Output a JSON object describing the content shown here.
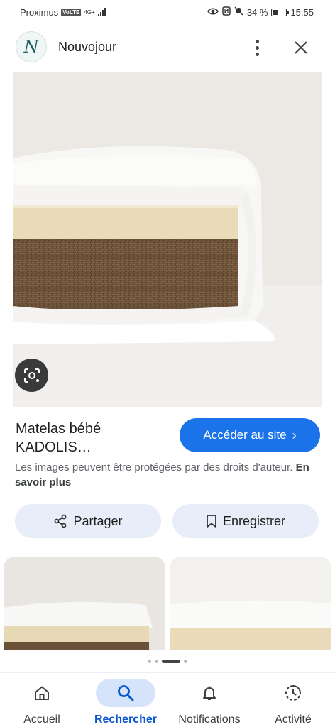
{
  "status_bar": {
    "carrier": "Proximus",
    "volte_badge": "VoLTE",
    "network": "4G+",
    "battery": "34 %",
    "battery_level": 0.34,
    "time": "15:55"
  },
  "header": {
    "logo_letter": "N",
    "site_name": "Nouvojour",
    "more_icon": "more-vertical-icon",
    "close_icon": "close-icon"
  },
  "image_result": {
    "lens_icon": "lens-search-icon",
    "title": "Matelas bébé KADOLIS…",
    "visit_label": "Accéder au site",
    "visit_chevron": "›",
    "copyright_text": "Les images peuvent être protégées par des droits d'auteur.",
    "learn_more": "En savoir plus"
  },
  "actions": {
    "share_label": "Partager",
    "save_label": "Enregistrer"
  },
  "carousel": {
    "page_count": 4,
    "active_index": 2
  },
  "bottom_nav": [
    {
      "label": "Accueil",
      "icon": "home-icon"
    },
    {
      "label": "Rechercher",
      "icon": "search-icon"
    },
    {
      "label": "Notifications",
      "icon": "bell-icon"
    },
    {
      "label": "Activité",
      "icon": "activity-icon"
    }
  ],
  "colors": {
    "accent": "#1a73e8",
    "nav_active": "#0b57d0",
    "chip_bg": "#e8eef9"
  }
}
